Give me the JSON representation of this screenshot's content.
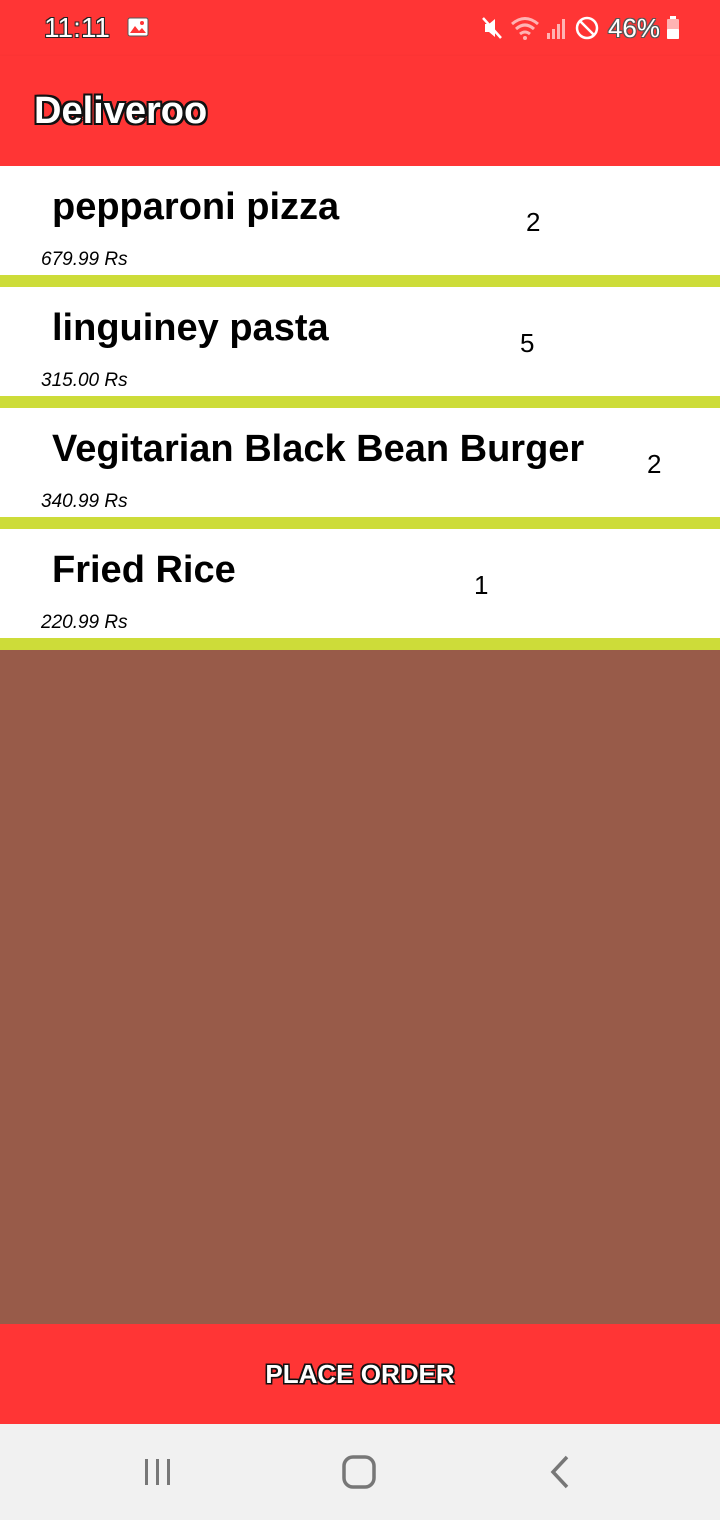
{
  "status_bar": {
    "time": "11:11",
    "battery_percent": "46%",
    "icons": [
      "gallery-icon",
      "mute-icon",
      "wifi-icon",
      "signal-icon",
      "do-not-disturb-icon",
      "battery-icon"
    ]
  },
  "app_bar": {
    "title": "Deliveroo"
  },
  "order_items": [
    {
      "name": "pepparoni pizza",
      "quantity": "2",
      "price": "679.99 Rs"
    },
    {
      "name": "linguiney pasta",
      "quantity": "5",
      "price": "315.00 Rs"
    },
    {
      "name": "Vegitarian Black Bean Burger",
      "quantity": "2",
      "price": "340.99 Rs"
    },
    {
      "name": "Fried Rice",
      "quantity": "1",
      "price": "220.99 Rs"
    }
  ],
  "place_order_label": "PLACE ORDER",
  "nav_bar": {
    "icons": [
      "recent-apps-icon",
      "home-icon",
      "back-icon"
    ]
  },
  "colors": {
    "primary": "#ff3535",
    "divider": "#cddc39",
    "background": "#985b49",
    "nav_background": "#f1f1f1"
  }
}
